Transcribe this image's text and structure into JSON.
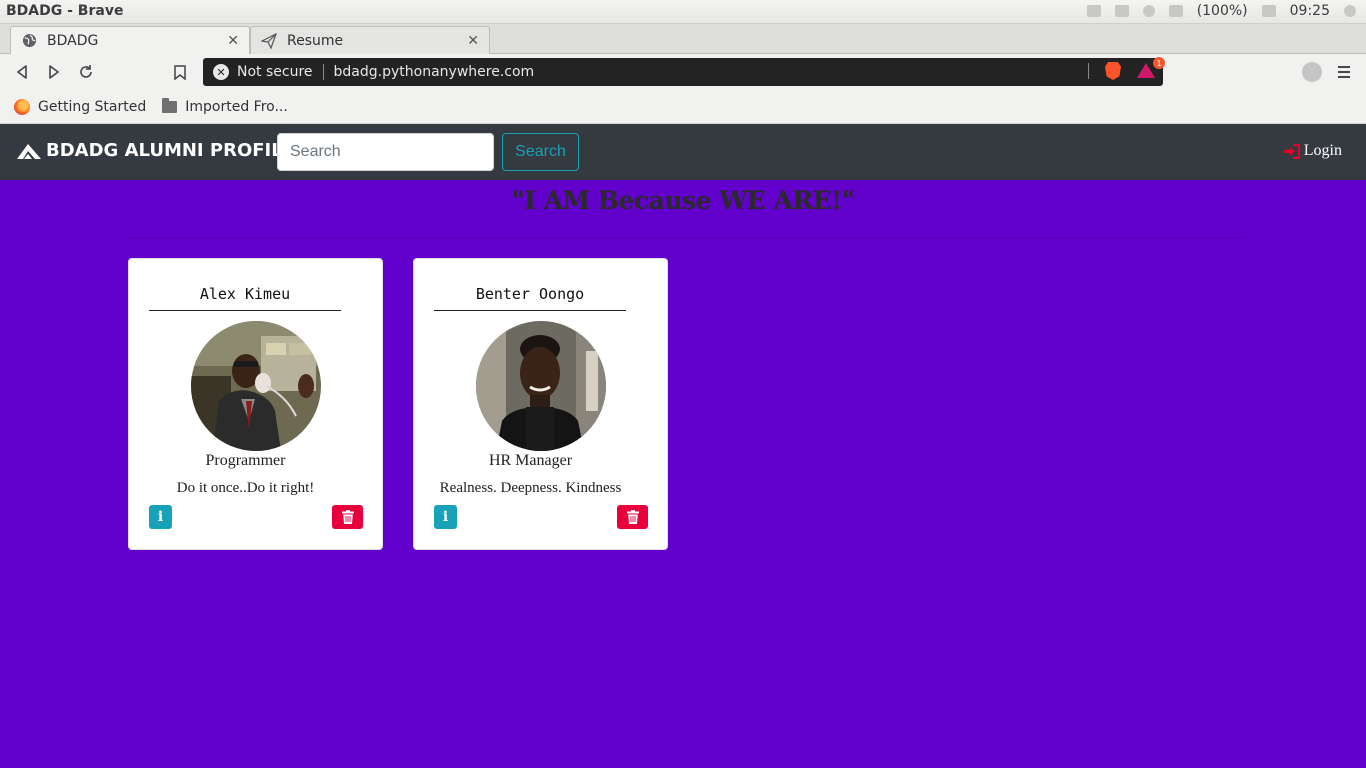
{
  "os": {
    "window_title": "BDADG - Brave",
    "battery": "(100%)",
    "clock": "09:25"
  },
  "browser": {
    "tabs": [
      {
        "label": "BDADG",
        "icon": "globe-icon",
        "active": true
      },
      {
        "label": "Resume",
        "icon": "paper-plane-icon",
        "active": false
      }
    ],
    "security_label": "Not secure",
    "url": "bdadg.pythonanywhere.com",
    "rewards_badge": "1",
    "bookmarks": [
      {
        "label": "Getting Started",
        "icon": "firefox-icon"
      },
      {
        "label": "Imported Fro...",
        "icon": "folder-icon"
      }
    ]
  },
  "site": {
    "brand": "BDADG ALUMNI PROFILES",
    "search_placeholder": "Search",
    "search_button": "Search",
    "login_label": "Login",
    "motto": "\"I AM Because WE ARE!\""
  },
  "profiles": [
    {
      "name": "Alex Kimeu",
      "role": "Programmer",
      "quote": "Do it once..Do it right!",
      "info_label": "i"
    },
    {
      "name": "Benter Oongo",
      "role": "HR Manager",
      "quote": "Realness. Deepness. Kindness",
      "info_label": "i"
    }
  ],
  "colors": {
    "page_background": "#6200cc",
    "navbar": "#343a40",
    "info": "#17a2b8",
    "danger": "#e8003d"
  }
}
